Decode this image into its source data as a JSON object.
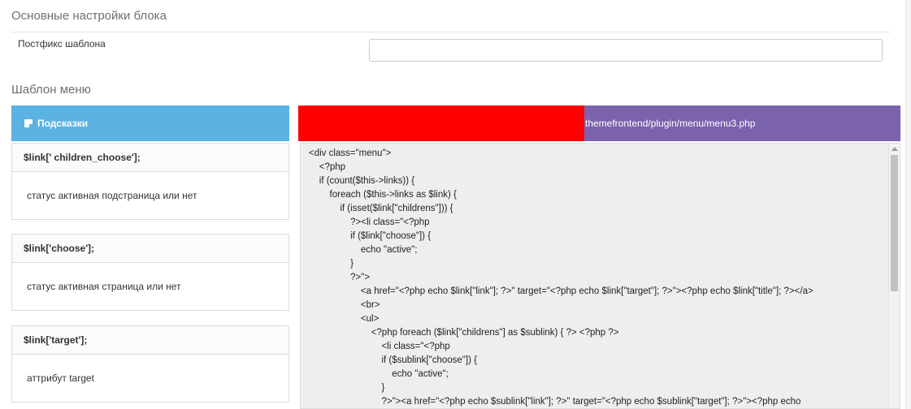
{
  "settings": {
    "section_title": "Основные настройки блока",
    "postfix_label": "Постфикс шаблона",
    "postfix_value": ""
  },
  "template": {
    "section_title": "Шаблон меню"
  },
  "hints": {
    "header_label": "Подсказки",
    "icon": "note-icon",
    "items": [
      {
        "key": "$link[' children_choose'];",
        "desc": "статус активная подстраница или нет"
      },
      {
        "key": "$link['choose'];",
        "desc": "статус активная страница или нет"
      },
      {
        "key": "$link['target'];",
        "desc": "аттрибут target"
      }
    ]
  },
  "editor": {
    "file_path": "themefrontend/plugin/menu/menu3.php",
    "code": "<div class=\"menu\">\n    <?php\n    if (count($this->links)) {\n        foreach ($this->links as $link) {\n            if (isset($link[\"childrens\"])) {\n                ?><li class=\"<?php\n                if ($link[\"choose\"]) {\n                    echo \"active\";\n                }\n                ?>\">\n                    <a href=\"<?php echo $link[\"link\"]; ?>\" target=\"<?php echo $link[\"target\"]; ?>\"><?php echo $link[\"title\"]; ?></a>\n                    <br>\n                    <ul>\n                        <?php foreach ($link[\"childrens\"] as $sublink) { ?> <?php ?>\n                            <li class=\"<?php\n                            if ($sublink[\"choose\"]) {\n                                echo \"active\";\n                            }\n                            ?>\"><a href=\"<?php echo $sublink[\"link\"]; ?>\" target=\"<?php echo $sublink[\"target\"]; ?>\"><?php echo"
  },
  "colors": {
    "hints_header": "#5bb3e3",
    "file_header": "#7b62ad",
    "redaction": "#ff0000",
    "code_background": "#eeeeee"
  }
}
